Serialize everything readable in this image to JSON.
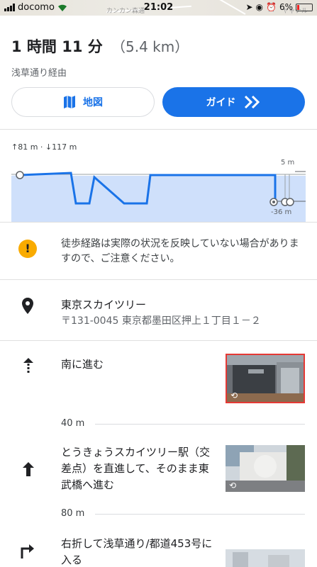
{
  "status_bar": {
    "carrier": "docomo",
    "time": "21:02",
    "battery": "6%",
    "map_labels": [
      "カンカン森通",
      "ヤャナル"
    ]
  },
  "summary": {
    "duration": "1 時間 11 分",
    "distance": "（5.4 km）",
    "via": "浅草通り経由",
    "map_button": "地図",
    "guide_button": "ガイド"
  },
  "elevation": {
    "stats": "↑81 m · ↓117 m",
    "top_label": "5 m",
    "bottom_label": "-36 m"
  },
  "warning": {
    "text": "徒歩経路は実際の状況を反映していない場合がありますので、ご注意ください。"
  },
  "destination": {
    "name": "東京スカイツリー",
    "address": "〒131-0045 東京都墨田区押上１丁目１－２"
  },
  "steps": [
    {
      "text": "南に進む",
      "icon": "arrow-up-dotted-icon",
      "distance_after": "40 m"
    },
    {
      "text": "とうきょうスカイツリー駅（交差点）を直進して、そのまま東武橋へ進む",
      "icon": "arrow-up-icon",
      "distance_after": "80 m"
    },
    {
      "text": "右折して浅草通り/都道453号に入る",
      "icon": "turn-right-icon"
    }
  ],
  "colors": {
    "accent": "#1a73e8",
    "warning": "#f9ab00",
    "elevation_fill": "#cfe0fb"
  }
}
